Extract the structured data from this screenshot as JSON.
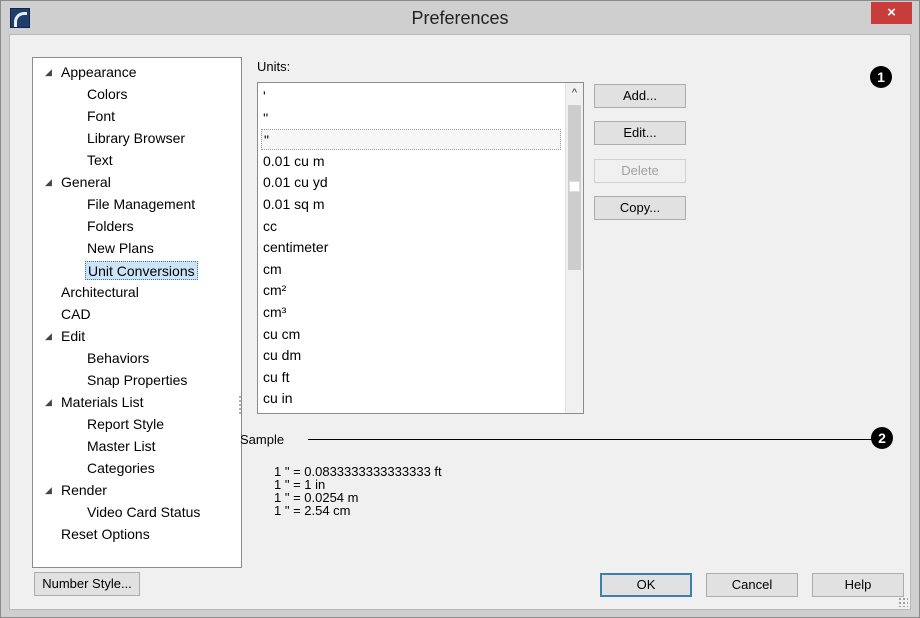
{
  "window": {
    "title": "Preferences",
    "close_label": "×"
  },
  "tree": {
    "items": [
      {
        "label": "Appearance",
        "level": 0,
        "expanded": true
      },
      {
        "label": "Colors",
        "level": 1
      },
      {
        "label": "Font",
        "level": 1
      },
      {
        "label": "Library Browser",
        "level": 1
      },
      {
        "label": "Text",
        "level": 1
      },
      {
        "label": "General",
        "level": 0,
        "expanded": true
      },
      {
        "label": "File Management",
        "level": 1
      },
      {
        "label": "Folders",
        "level": 1
      },
      {
        "label": "New Plans",
        "level": 1
      },
      {
        "label": "Unit Conversions",
        "level": 1,
        "selected": true
      },
      {
        "label": "Architectural",
        "level": 0
      },
      {
        "label": "CAD",
        "level": 0
      },
      {
        "label": "Edit",
        "level": 0,
        "expanded": true
      },
      {
        "label": "Behaviors",
        "level": 1
      },
      {
        "label": "Snap Properties",
        "level": 1
      },
      {
        "label": "Materials List",
        "level": 0,
        "expanded": true
      },
      {
        "label": "Report Style",
        "level": 1
      },
      {
        "label": "Master List",
        "level": 1
      },
      {
        "label": "Categories",
        "level": 1
      },
      {
        "label": "Render",
        "level": 0,
        "expanded": true
      },
      {
        "label": "Video Card Status",
        "level": 1
      },
      {
        "label": "Reset Options",
        "level": 0
      }
    ],
    "expander_glyph": "◢"
  },
  "units": {
    "label": "Units:",
    "items": [
      "'",
      "''",
      "\"",
      "0.01 cu m",
      "0.01 cu yd",
      "0.01 sq m",
      "cc",
      "centimeter",
      "cm",
      "cm²",
      "cm³",
      "cu cm",
      "cu dm",
      "cu ft",
      "cu in"
    ],
    "focused_index": 2,
    "scroll_up_glyph": "^"
  },
  "buttons": {
    "add": "Add...",
    "edit": "Edit...",
    "delete": "Delete",
    "copy": "Copy...",
    "number_style": "Number Style...",
    "ok": "OK",
    "cancel": "Cancel",
    "help": "Help"
  },
  "sample": {
    "label": "Sample",
    "lines": [
      "1 \" = 0.0833333333333333 ft",
      "1 \" = 1 in",
      "1 \" = 0.0254 m",
      "1 \" = 2.54 cm"
    ]
  },
  "markers": {
    "m1": "1",
    "m2": "2"
  }
}
